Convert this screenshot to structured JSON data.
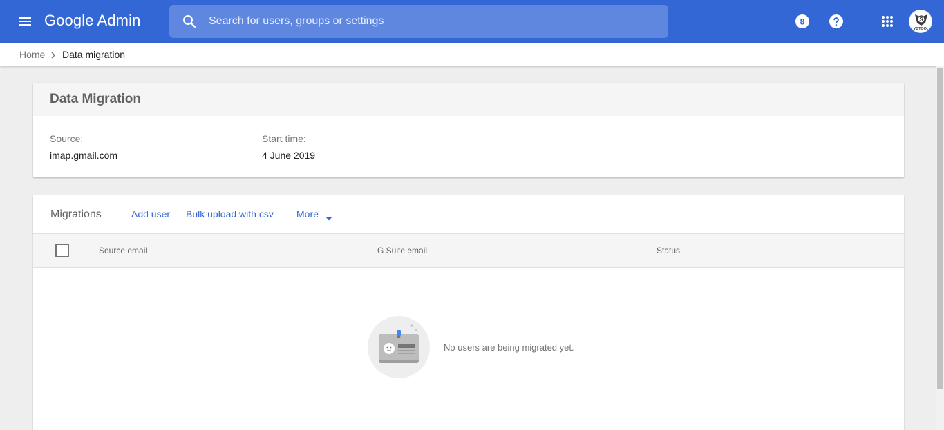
{
  "header": {
    "app_title": "Google Admin",
    "search_placeholder": "Search for users, groups or settings",
    "brand_color": "#3367d6",
    "icons": [
      "menu-icon",
      "search-icon",
      "notifications-count-icon",
      "help-icon",
      "apps-grid-icon",
      "account-avatar"
    ],
    "notification_count": "8",
    "avatar_text": "YSTOOL"
  },
  "breadcrumb": {
    "home": "Home",
    "current": "Data migration"
  },
  "info_card": {
    "title": "Data Migration",
    "source_label": "Source:",
    "source_value": "imap.gmail.com",
    "start_label": "Start time:",
    "start_value": "4 June 2019"
  },
  "migrations": {
    "title": "Migrations",
    "add_user": "Add user",
    "bulk_upload": "Bulk upload with csv",
    "more": "More",
    "columns": [
      "Source email",
      "G Suite email",
      "Status"
    ],
    "rows": [],
    "empty_message": "No users are being migrated yet."
  }
}
